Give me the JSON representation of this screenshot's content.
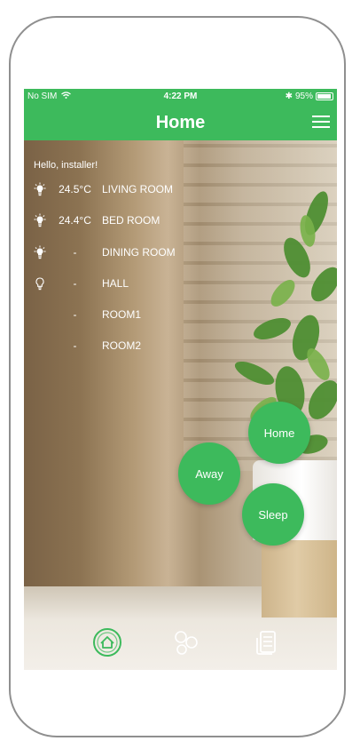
{
  "status_bar": {
    "carrier": "No SIM",
    "time": "4:22 PM",
    "battery": "95%",
    "bluetooth_glyph": "✱"
  },
  "nav": {
    "title": "Home"
  },
  "greeting": "Hello, installer!",
  "rooms": [
    {
      "temp": "24.5°C",
      "name": "LIVING ROOM",
      "light": "on"
    },
    {
      "temp": "24.4°C",
      "name": "BED ROOM",
      "light": "on"
    },
    {
      "temp": "-",
      "name": "DINING ROOM",
      "light": "on"
    },
    {
      "temp": "-",
      "name": "HALL",
      "light": "off"
    },
    {
      "temp": "-",
      "name": "ROOM1",
      "light": "none"
    },
    {
      "temp": "-",
      "name": "ROOM2",
      "light": "none"
    }
  ],
  "modes": {
    "home": "Home",
    "away": "Away",
    "sleep": "Sleep"
  },
  "tabs": [
    {
      "icon": "home-icon",
      "active": true
    },
    {
      "icon": "circles-icon",
      "active": false
    },
    {
      "icon": "document-list-icon",
      "active": false
    }
  ],
  "colors": {
    "accent": "#3dba5c"
  }
}
